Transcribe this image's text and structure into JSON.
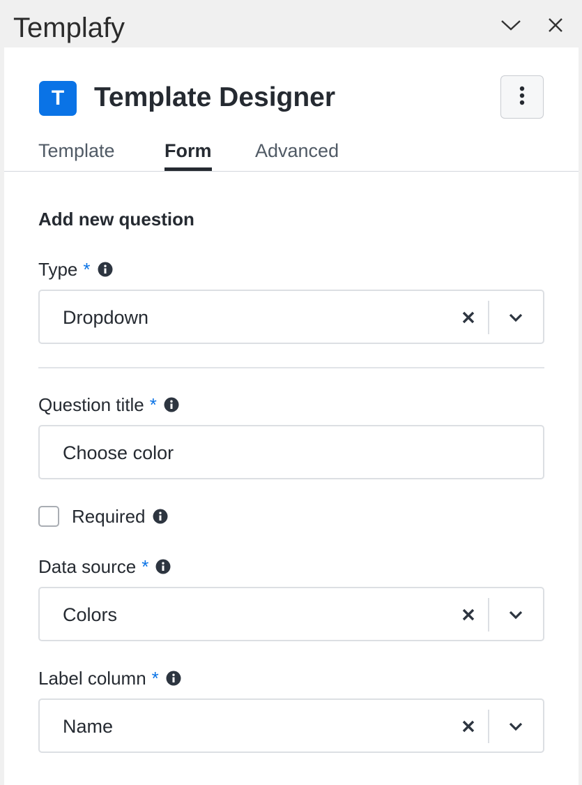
{
  "window": {
    "app_title": "Templafy",
    "minimize_icon": "chevron-down-icon",
    "close_icon": "close-icon"
  },
  "header": {
    "logo_letter": "T",
    "title": "Template Designer",
    "more_icon": "more-vertical-icon"
  },
  "tabs": [
    {
      "label": "Template",
      "active": false
    },
    {
      "label": "Form",
      "active": true
    },
    {
      "label": "Advanced",
      "active": false
    }
  ],
  "form": {
    "section_heading": "Add new question",
    "required_marker": "*",
    "type": {
      "label": "Type",
      "value": "Dropdown"
    },
    "question_title": {
      "label": "Question title",
      "value": "Choose color"
    },
    "required": {
      "label": "Required",
      "checked": false
    },
    "data_source": {
      "label": "Data source",
      "value": "Colors"
    },
    "label_column": {
      "label": "Label column",
      "value": "Name"
    }
  },
  "colors": {
    "accent": "#0a73e6",
    "text": "#252a31",
    "border": "#dcdfe3"
  }
}
